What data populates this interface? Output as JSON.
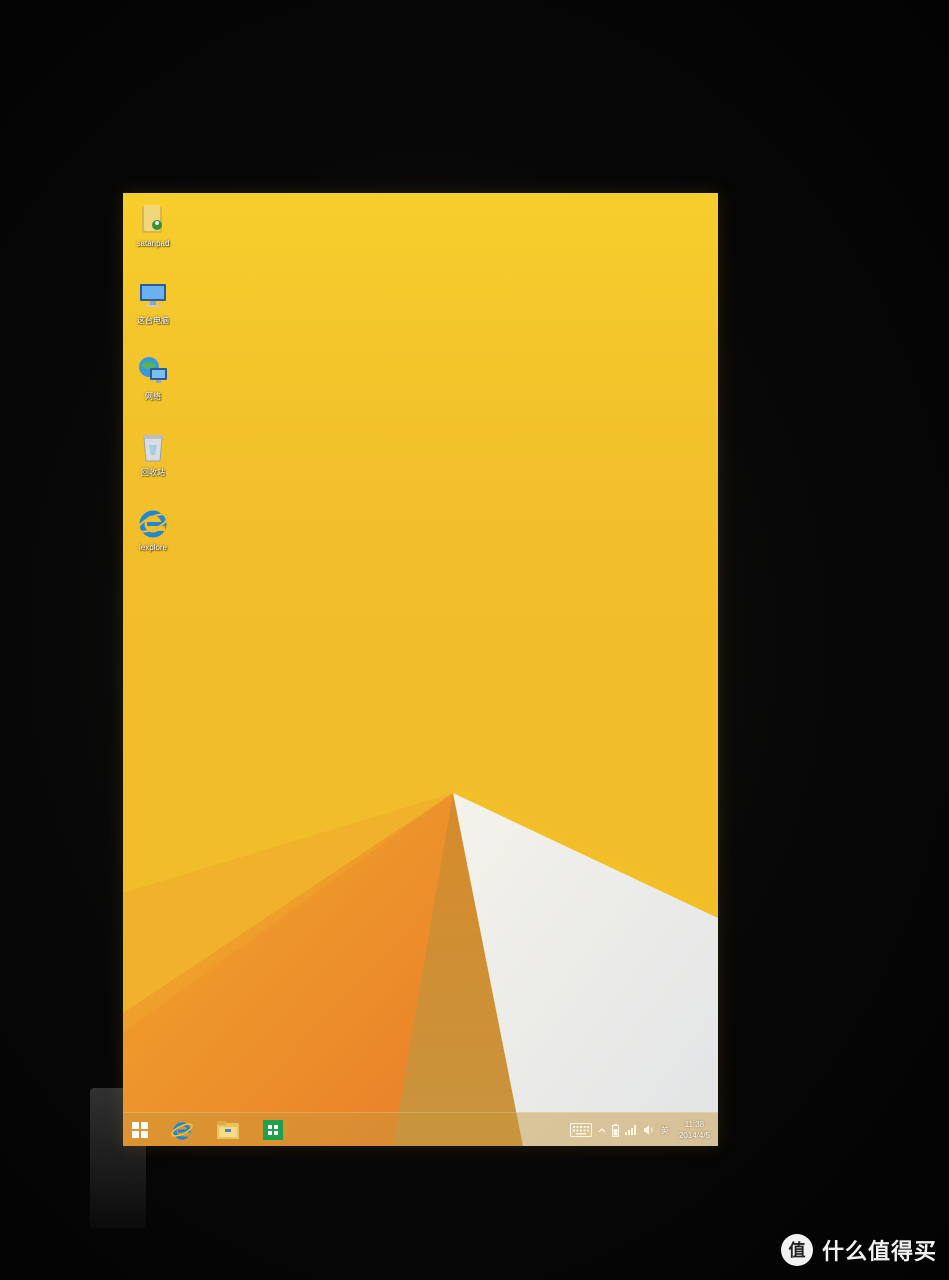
{
  "desktop": {
    "icons": [
      {
        "label": "satanpad",
        "icon": "user-folder-icon"
      },
      {
        "label": "这台电脑",
        "icon": "this-pc-icon"
      },
      {
        "label": "网络",
        "icon": "network-icon"
      },
      {
        "label": "回收站",
        "icon": "recycle-bin-icon"
      },
      {
        "label": "iexplore",
        "icon": "internet-explorer-icon"
      }
    ]
  },
  "taskbar": {
    "pinned": [
      "start-button",
      "internet-explorer-icon",
      "file-explorer-icon",
      "store-icon"
    ],
    "tray": {
      "language": "英",
      "time": "11:38",
      "date": "2014/4/5"
    }
  },
  "watermark": {
    "text": "什么值得买",
    "logo": "值"
  },
  "colors": {
    "wallpaper_yellow": "#f2c22a",
    "wallpaper_orange": "#e8822a",
    "wallpaper_white": "#e6e8ea"
  }
}
